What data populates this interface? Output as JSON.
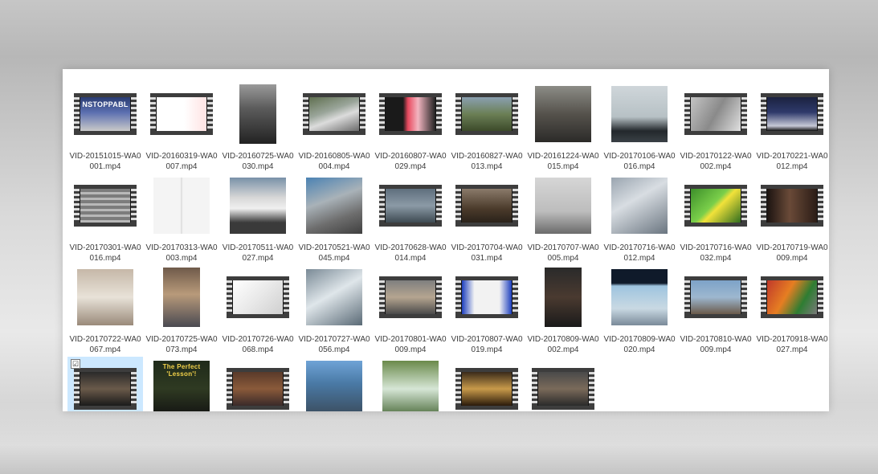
{
  "files": [
    {
      "name": "VID-20151015-WA0001.mp4",
      "thumb": "film",
      "fill": "linear-gradient(180deg,#2a3c72 0%,#5b6fb0 45%,#c9c9c9 100%)",
      "caption": "NSTOPPABL"
    },
    {
      "name": "VID-20160319-WA0007.mp4",
      "thumb": "film",
      "fill": "linear-gradient(90deg,#ffffff 0%,#ffffff 55%,#ffe3e3 100%)"
    },
    {
      "name": "VID-20160725-WA0030.mp4",
      "thumb": "tall",
      "fill": "linear-gradient(180deg,#9a9a9a 0%,#5c5c5c 40%,#222 100%)"
    },
    {
      "name": "VID-20160805-WA0004.mp4",
      "thumb": "film",
      "fill": "linear-gradient(160deg,#5f6f4f 0%,#9aa59a 40%,#dcdcdc 60%,#6b6b6b 100%)"
    },
    {
      "name": "VID-20160807-WA0029.mp4",
      "thumb": "film",
      "fill": "linear-gradient(90deg,#1a1a1a 0%,#1a1a1a 35%,#e84a5f 45%,#f2b5c0 65%,#222 100%)"
    },
    {
      "name": "VID-20160827-WA0013.mp4",
      "thumb": "film",
      "fill": "linear-gradient(180deg,#8aa0b0 0%,#6b7f55 50%,#3c4a2a 100%)"
    },
    {
      "name": "VID-20161224-WA0015.mp4",
      "thumb": "square",
      "fill": "linear-gradient(180deg,#8c8c86 0%,#55524c 50%,#2b2a28 100%)"
    },
    {
      "name": "VID-20170106-WA0016.mp4",
      "thumb": "square",
      "fill": "linear-gradient(180deg,#cfd6da 0%,#b7c1c5 55%,#23282c 80%,#3a4146 100%)"
    },
    {
      "name": "VID-20170122-WA0002.mp4",
      "thumb": "film",
      "fill": "linear-gradient(120deg,#c4c4c4 0%,#8a8a8a 50%,#e0e0e0 100%)"
    },
    {
      "name": "VID-20170221-WA0012.mp4",
      "thumb": "film",
      "fill": "linear-gradient(180deg,#1b2240 0%,#2f3a6b 45%,#c6c8d6 85%,#101010 100%)"
    },
    {
      "name": "VID-20170301-WA0016.mp4",
      "thumb": "film",
      "fill": "repeating-linear-gradient(180deg,#7c7c7c 0 4px,#b8b8b8 4px 7px)"
    },
    {
      "name": "VID-20170313-WA0003.mp4",
      "thumb": "square",
      "fill": "linear-gradient(90deg,#f4f4f4 0%,#f4f4f4 48%,#d8d8d8 50%,#f4f4f4 52%)"
    },
    {
      "name": "VID-20170511-WA0027.mp4",
      "thumb": "square",
      "fill": "linear-gradient(180deg,#7891a8 0%,#d6d6d6 35%,#f0f0f0 55%,#3a3a3a 80%)"
    },
    {
      "name": "VID-20170521-WA0045.mp4",
      "thumb": "square",
      "fill": "linear-gradient(160deg,#4b82b3 0%,#a9b2b8 40%,#6d6d6d 70%,#3f3f3f 100%)"
    },
    {
      "name": "VID-20170628-WA0014.mp4",
      "thumb": "film",
      "fill": "linear-gradient(180deg,#5f6f7d 0%,#8b9aa6 50%,#3e4a52 100%)"
    },
    {
      "name": "VID-20170704-WA0031.mp4",
      "thumb": "film",
      "fill": "linear-gradient(180deg,#8a7a6a 0%,#4a3a2a 60%,#2a221a 100%)"
    },
    {
      "name": "VID-20170707-WA0005.mp4",
      "thumb": "square",
      "fill": "linear-gradient(180deg,#d6d6d6 0%,#bdbdbd 60%,#6b6b6b 100%)"
    },
    {
      "name": "VID-20170716-WA0012.mp4",
      "thumb": "square",
      "fill": "linear-gradient(150deg,#9aa5b0 0%,#d8dde2 40%,#6a7580 100%)"
    },
    {
      "name": "VID-20170716-WA0032.mp4",
      "thumb": "film",
      "fill": "linear-gradient(135deg,#3c8f2a 0%,#7bcf4a 45%,#f2e23a 55%,#2f6d1f 100%)"
    },
    {
      "name": "VID-20170719-WA0009.mp4",
      "thumb": "film",
      "fill": "linear-gradient(90deg,#1c1411 0%,#6a4a38 45%,#2a1c16 100%)"
    },
    {
      "name": "VID-20170722-WA0067.mp4",
      "thumb": "square",
      "fill": "linear-gradient(180deg,#c6b8a8 0%,#e8e2d8 50%,#9a8a7a 100%)"
    },
    {
      "name": "VID-20170725-WA0073.mp4",
      "thumb": "tall",
      "fill": "linear-gradient(180deg,#6f5a4a 0%,#b89a7a 45%,#4a4a52 100%)"
    },
    {
      "name": "VID-20170726-WA0068.mp4",
      "thumb": "film",
      "fill": "linear-gradient(135deg,#ffffff 0%,#e9e9e9 50%,#cfcfcf 100%)"
    },
    {
      "name": "VID-20170727-WA0056.mp4",
      "thumb": "square",
      "fill": "linear-gradient(150deg,#7a8a96 0%,#dfe6ea 45%,#5a6a76 100%)"
    },
    {
      "name": "VID-20170801-WA0009.mp4",
      "thumb": "film",
      "fill": "linear-gradient(180deg,#7f7f7f 0%,#b5a590 50%,#4a4a4a 100%)"
    },
    {
      "name": "VID-20170807-WA0019.mp4",
      "thumb": "film",
      "fill": "linear-gradient(90deg,#1d3fbf 0%,#f2f2f2 25%,#f2f2f2 75%,#1d3fbf 100%)"
    },
    {
      "name": "VID-20170809-WA0002.mp4",
      "thumb": "tall",
      "fill": "linear-gradient(180deg,#2a2a2a 0%,#4a3a30 50%,#1a1a1a 100%)"
    },
    {
      "name": "VID-20170809-WA0020.mp4",
      "thumb": "square",
      "fill": "linear-gradient(180deg,#0f1a2a 0%,#0f1a2a 25%,#9ec4df 30%,#c9d9e3 70%,#7a8a99 100%)"
    },
    {
      "name": "VID-20170810-WA0009.mp4",
      "thumb": "film",
      "fill": "linear-gradient(180deg,#7da2c8 0%,#9db7cf 50%,#6a5a4a 100%)"
    },
    {
      "name": "VID-20170918-WA0027.mp4",
      "thumb": "film",
      "fill": "linear-gradient(120deg,#c0392b 0%,#e67e22 40%,#2e7d32 70%,#7a7a7a 100%)"
    },
    {
      "name": "",
      "thumb": "film",
      "fill": "linear-gradient(180deg,#2a2a2a 0%,#6a5a4a 50%,#1a1a1a 100%)",
      "selected": true,
      "check": "☑"
    },
    {
      "name": "",
      "thumb": "square",
      "fill": "linear-gradient(180deg,#1f2a1a 0%,#2f3a22 50%,#121212 100%)",
      "caption": "The Perfect 'Lesson'!"
    },
    {
      "name": "",
      "thumb": "film",
      "fill": "linear-gradient(180deg,#5a3a2a 0%,#8a5a3a 50%,#3a2a2a 100%)"
    },
    {
      "name": "",
      "thumb": "square",
      "fill": "linear-gradient(180deg,#6fa3d6 0%,#4a7aa6 40%,#3a4a5a 100%)"
    },
    {
      "name": "",
      "thumb": "square",
      "fill": "linear-gradient(180deg,#6a8a4a 0%,#d6e6d6 50%,#4a6a3a 100%)"
    },
    {
      "name": "",
      "thumb": "film",
      "fill": "linear-gradient(180deg,#3a2a1a 0%,#c89a4a 50%,#2a1a0a 100%)"
    },
    {
      "name": "",
      "thumb": "film",
      "fill": "linear-gradient(180deg,#4a4a4a 0%,#7a6a5a 50%,#2a2a2a 100%)"
    }
  ]
}
